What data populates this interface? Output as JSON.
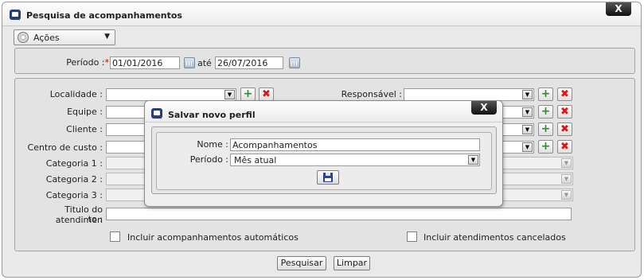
{
  "window": {
    "title": "Pesquisa de acompanhamentos",
    "close_label": "X"
  },
  "actions_menu": {
    "label": "Ações"
  },
  "period": {
    "label": "Período :",
    "required_mark": "*",
    "start": "01/01/2016",
    "separator": "até",
    "end": "26/07/2016"
  },
  "filters": {
    "localidade": "Localidade :",
    "equipe": "Equipe :",
    "cliente": "Cliente :",
    "centro_custo": "Centro de custo :",
    "categoria1": "Categoria 1 :",
    "categoria2": "Categoria 2 :",
    "categoria3": "Categoria 3 :",
    "titulo_line1": "Titulo do atendimen",
    "titulo_line2": "to :",
    "responsavel": "Responsável :"
  },
  "checkboxes": {
    "auto": "Incluir acompanhamentos automáticos",
    "cancelados": "Incluir atendimentos cancelados"
  },
  "buttons": {
    "pesquisar": "Pesquisar",
    "limpar": "Limpar"
  },
  "modal": {
    "title": "Salvar novo perfil",
    "close_label": "X",
    "nome_label": "Nome :",
    "nome_value": "Acompanhamentos",
    "periodo_label": "Período :",
    "periodo_value": "Mês atual"
  },
  "icons": {
    "app": "chat-window-icon",
    "add": "add-icon",
    "remove": "remove-icon",
    "calendar": "calendar-icon",
    "save": "floppy-disk-icon",
    "actions": "gear-icon"
  }
}
